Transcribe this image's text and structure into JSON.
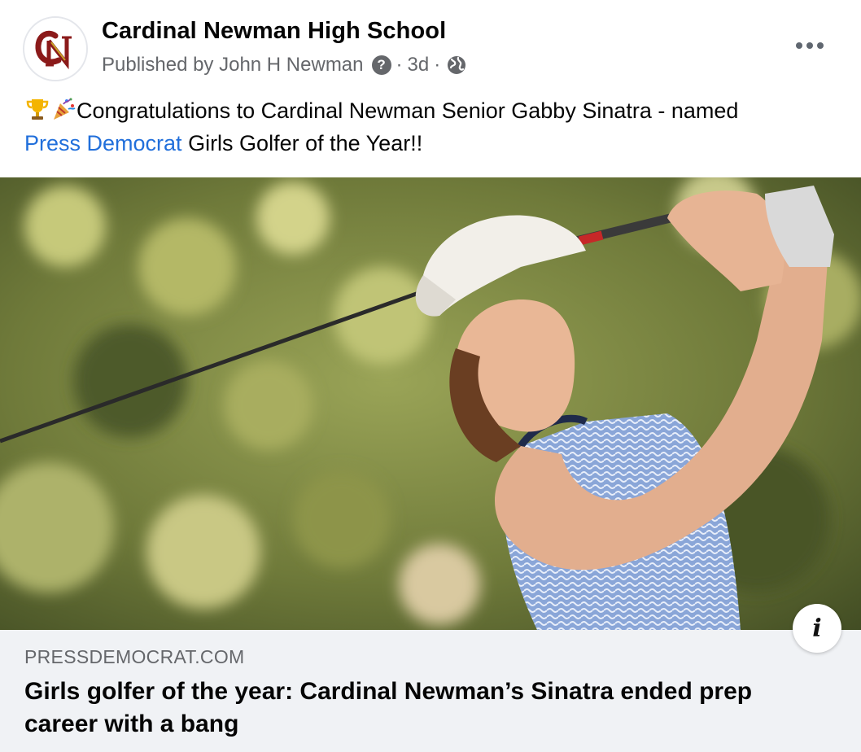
{
  "post": {
    "page_name": "Cardinal Newman High School",
    "published_by": "Published by John H Newman",
    "help_icon": "?",
    "time": "3d",
    "separator": "·",
    "privacy_icon": "globe-icon",
    "more_icon": "more-horizontal-icon",
    "text_before_link": "Congratulations to Cardinal Newman Senior Gabby Sinatra - named",
    "link_text": "Press Democrat",
    "text_after_link": " Girls Golfer of the Year!!",
    "emojis": [
      "trophy-icon",
      "party-popper-icon"
    ]
  },
  "logo": {
    "text": "CN",
    "color": "#8b1a1a",
    "gold": "#c9a227"
  },
  "link_preview": {
    "domain": "PRESSDEMOCRAT.COM",
    "headline": "Girls golfer of the year: Cardinal Newman’s Sinatra ended prep career with a bang",
    "info_icon": "i"
  },
  "colors": {
    "link": "#216fdb",
    "meta": "#65676b",
    "preview_bg": "#f0f2f5"
  }
}
